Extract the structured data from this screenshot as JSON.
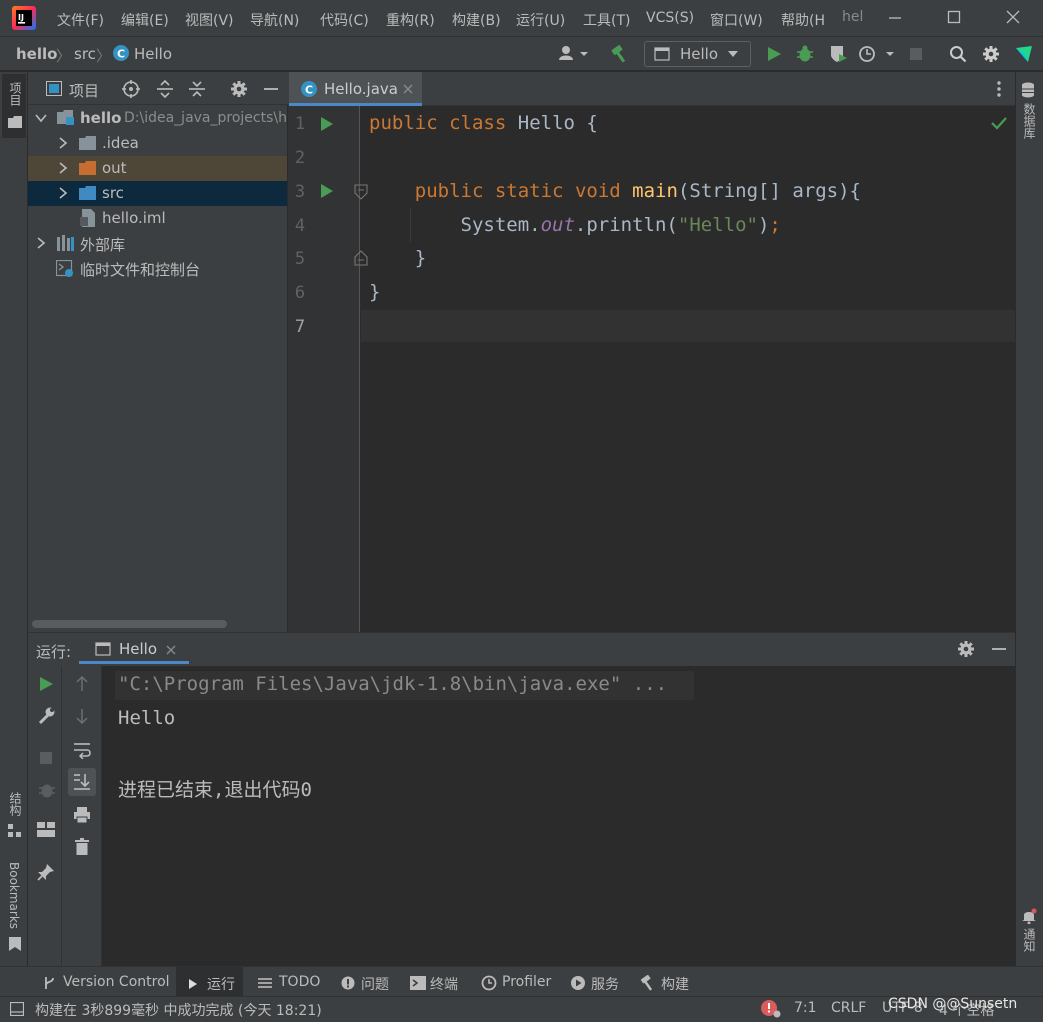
{
  "menu": [
    "文件(F)",
    "编辑(E)",
    "视图(V)",
    "导航(N)",
    "代码(C)",
    "重构(R)",
    "构建(B)",
    "运行(U)",
    "工具(T)",
    "VCS(S)",
    "窗口(W)",
    "帮助(H"
  ],
  "window_title": "hel",
  "breadcrumb": {
    "project": "hello",
    "folder": "src",
    "file": "Hello"
  },
  "run_config": "Hello",
  "left_stripe": {
    "project": "项目",
    "structure": "结构",
    "bookmarks": "Bookmarks"
  },
  "right_stripe": {
    "database": "数据库",
    "notifications": "通知"
  },
  "project_panel": {
    "title": "项目"
  },
  "tree": [
    {
      "name": "hello",
      "extra": "D:\\idea_java_projects\\h",
      "kind": "project"
    },
    {
      "name": ".idea",
      "kind": "folder-gray"
    },
    {
      "name": "out",
      "kind": "folder-orange"
    },
    {
      "name": "src",
      "kind": "folder-blue"
    },
    {
      "name": "hello.iml",
      "kind": "file"
    },
    {
      "name": "外部库",
      "kind": "lib"
    },
    {
      "name": "临时文件和控制台",
      "kind": "scratch"
    }
  ],
  "editor": {
    "tab": "Hello.java",
    "line_numbers": [
      "1",
      "2",
      "3",
      "4",
      "5",
      "6",
      "7"
    ],
    "code": {
      "l1": {
        "kw1": "public",
        "kw2": "class",
        "name": "Hello",
        "brace": "{"
      },
      "l3": {
        "kw1": "public",
        "kw2": "static",
        "kw3": "void",
        "fn": "main",
        "rest": "(String[] args){"
      },
      "l4": {
        "a": "System.",
        "field": "out",
        "b": ".println(",
        "str": "\"Hello\"",
        "c": ")",
        "semi": ";"
      },
      "l5": "}",
      "l6": "}"
    }
  },
  "run_panel": {
    "label": "运行:",
    "tab": "Hello",
    "console": [
      "\"C:\\Program Files\\Java\\jdk-1.8\\bin\\java.exe\" ...",
      "Hello",
      "进程已结束,退出代码0"
    ]
  },
  "tool_windows": [
    "Version Control",
    "运行",
    "TODO",
    "问题",
    "终端",
    "Profiler",
    "服务",
    "构建"
  ],
  "status": {
    "message": "构建在 3秒899毫秒 中成功完成 (今天 18:21)",
    "position": "7:1",
    "line_sep": "CRLF",
    "encoding": "UTF-8",
    "indent": "4 个空格",
    "watermark": "CSDN @@Sunsetn"
  },
  "colors": {
    "keyword": "#cc7832",
    "function": "#ffc66d",
    "string": "#6a8759",
    "field": "#9876aa",
    "accent": "#4a88c7",
    "run_green": "#499c54"
  }
}
